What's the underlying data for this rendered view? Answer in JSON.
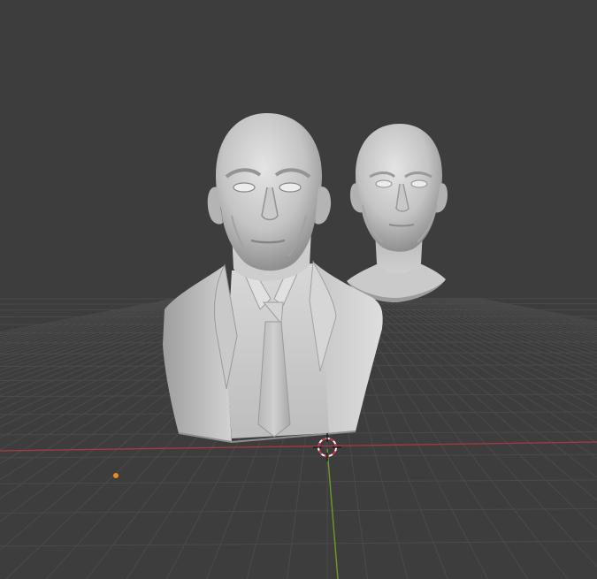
{
  "app": {
    "name": "3D Viewport",
    "view": "solid-shading"
  },
  "scene": {
    "objects": [
      {
        "name": "bust-suit",
        "kind": "sculpt-mesh"
      },
      {
        "name": "head-bust",
        "kind": "sculpt-mesh"
      }
    ],
    "cursor": "3d-cursor-icon",
    "light": "point-light-icon"
  },
  "colors": {
    "background": "#3d3d3d",
    "grid_line": "#4a4a4a",
    "x_axis": "#9c3a45",
    "y_axis": "#6b9a2a",
    "mesh_light": "#d4d4d4",
    "mesh_mid": "#b4b4b4",
    "mesh_dark": "#8e8e8e",
    "origin_dot": "#f08a1c",
    "cursor_red": "#d8374a"
  }
}
